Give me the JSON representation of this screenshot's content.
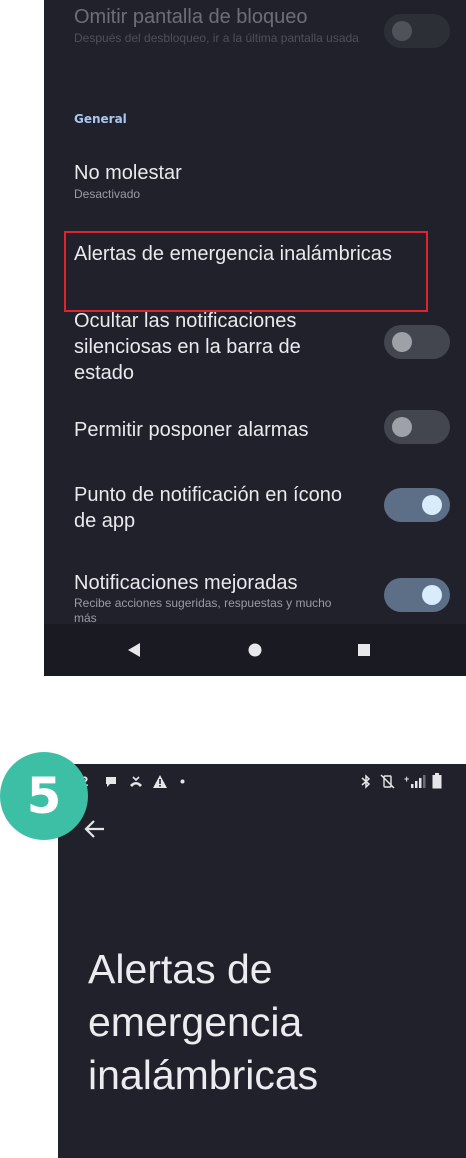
{
  "top_screen": {
    "rows": [
      {
        "title": "Omitir pantalla de bloqueo",
        "subtitle": "Después del desbloqueo, ir a la última pantalla usada",
        "toggle": "off",
        "disabled": true
      }
    ],
    "section_header": "General",
    "do_not_disturb": {
      "title": "No molestar",
      "subtitle": "Desactivado"
    },
    "emergency_alerts": {
      "title": "Alertas de emergencia inalámbricas"
    },
    "hide_silent": {
      "title": "Ocultar las notificaciones silenciosas en la barra de estado",
      "toggle": "off"
    },
    "snooze_alarms": {
      "title": "Permitir posponer alarmas",
      "toggle": "off"
    },
    "notification_dot": {
      "title": "Punto de notificación en ícono de app",
      "toggle": "on"
    },
    "enhanced_notifications": {
      "title": "Notificaciones mejoradas",
      "subtitle": "Recibe acciones sugeridas, respuestas y mucho más",
      "toggle": "on"
    },
    "nav": {
      "back_icon": "triangle-back-icon",
      "home_icon": "circle-home-icon",
      "recents_icon": "square-recents-icon"
    },
    "highlight_color": "#e0242e"
  },
  "step_badge": {
    "number": "5",
    "color": "#3cbfa5"
  },
  "bottom_screen": {
    "status_bar": {
      "time": ":52",
      "icons_left": [
        "chat-bubble-icon",
        "missed-call-icon",
        "warning-icon",
        "dot-icon"
      ],
      "icons_right": [
        "bluetooth-icon",
        "vibrate-off-icon",
        "signal-icon",
        "battery-icon"
      ],
      "network_label": "+"
    },
    "back_icon": "arrow-left-icon",
    "title": "Alertas de emergencia inalámbricas"
  },
  "colors": {
    "screen_bg": "#20212a",
    "toggle_on_track": "#5d6f86",
    "toggle_on_knob": "#d8ecfb",
    "toggle_off_track": "#43464e",
    "section_header": "#a9c8f1"
  }
}
